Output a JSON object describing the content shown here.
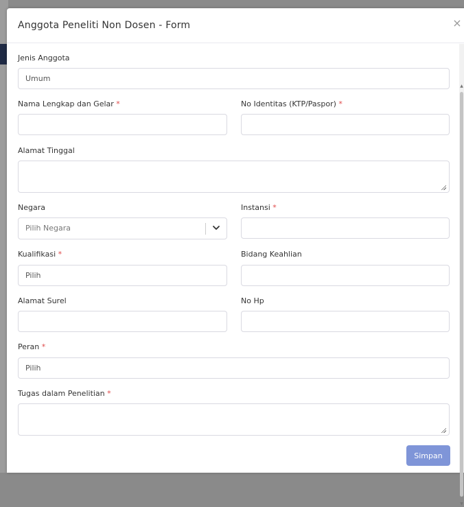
{
  "modal": {
    "title": "Anggota Peneliti Non Dosen - Form",
    "close_glyph": "×",
    "submit_label": "Simpan"
  },
  "form": {
    "jenis_anggota": {
      "label": "Jenis Anggota",
      "value": "Umum"
    },
    "nama_lengkap": {
      "label": "Nama Lengkap dan Gelar",
      "required_mark": "*",
      "value": ""
    },
    "no_identitas": {
      "label": "No Identitas (KTP/Paspor)",
      "required_mark": "*",
      "value": ""
    },
    "alamat_tinggal": {
      "label": "Alamat Tinggal",
      "value": ""
    },
    "negara": {
      "label": "Negara",
      "placeholder": "Pilih Negara"
    },
    "instansi": {
      "label": "Instansi",
      "required_mark": "*",
      "value": ""
    },
    "kualifikasi": {
      "label": "Kualifikasi",
      "required_mark": "*",
      "value": "Pilih"
    },
    "bidang_keahlian": {
      "label": "Bidang Keahlian",
      "value": ""
    },
    "alamat_surel": {
      "label": "Alamat Surel",
      "value": ""
    },
    "no_hp": {
      "label": "No Hp",
      "value": ""
    },
    "peran": {
      "label": "Peran",
      "required_mark": "*",
      "value": "Pilih"
    },
    "tugas": {
      "label": "Tugas dalam Penelitian",
      "required_mark": "*",
      "value": ""
    }
  },
  "icons": {
    "close": "close-icon",
    "select_arrow": "chevron-down-icon",
    "resize": "resize-grip-icon"
  },
  "colors": {
    "submit_button": "#7f95d8",
    "required_mark": "#e04a4a",
    "field_border": "#d9d9e1"
  }
}
